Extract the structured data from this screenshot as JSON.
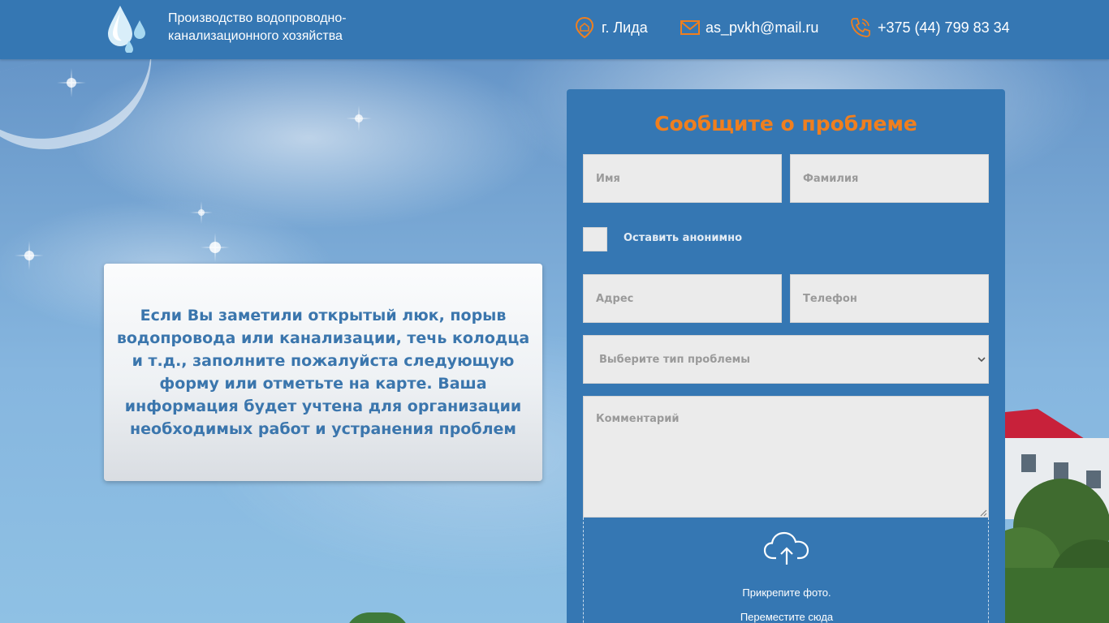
{
  "header": {
    "company_name": "Производство водопроводно-канализационного хозяйства",
    "city": "г. Лида",
    "email": "as_pvkh@mail.ru",
    "phone": "+375 (44) 799 83 34",
    "icons": [
      "water-drops-logo",
      "location-pin-icon",
      "mail-icon",
      "phone-icon"
    ]
  },
  "info": {
    "text": "Если Вы заметили открытый люк, порыв водопровода или канализации, течь колодца и т.д., заполните пожалуйста следующую форму или отметьте на карте. Ваша информация будет учтена для организации необходимых работ и устранения проблем"
  },
  "form": {
    "title": "Сообщите о проблеме",
    "name_placeholder": "Имя",
    "surname_placeholder": "Фамилия",
    "anonymous_label": "Оставить анонимно",
    "address_placeholder": "Адрес",
    "phone_placeholder": "Телефон",
    "problem_type_selected": "Выберите тип проблемы",
    "comment_placeholder": "Комментарий",
    "upload_line1": "Прикрепите фото.",
    "upload_line2": "Переместите сюда"
  },
  "colors": {
    "header_bg": "#3577b3",
    "accent_orange": "#f07f1e",
    "info_text": "#3b76ad",
    "field_bg": "#ebebeb"
  }
}
